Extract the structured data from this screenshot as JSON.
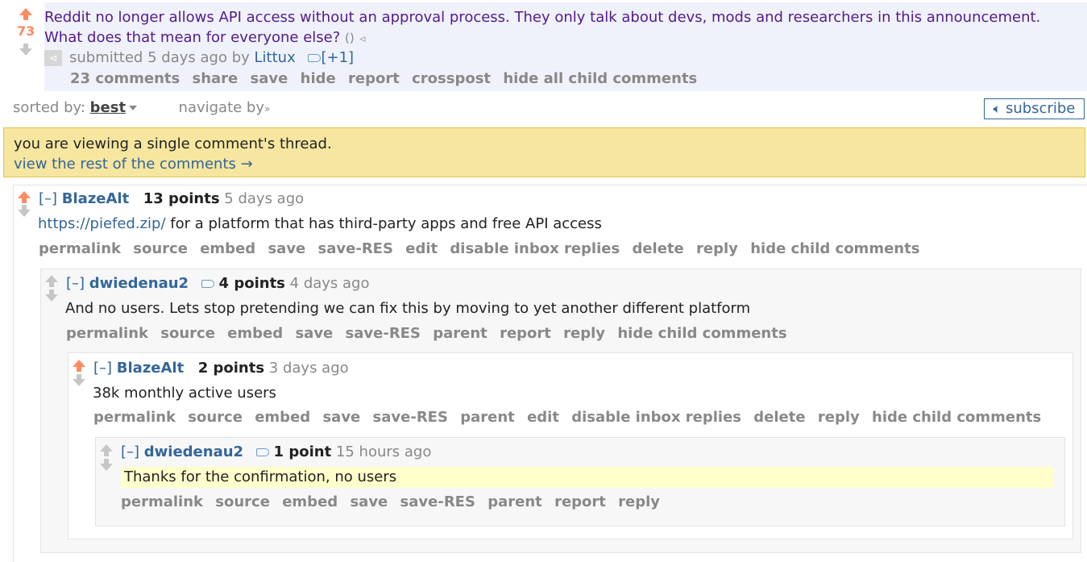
{
  "post": {
    "score": "73",
    "title": "Reddit no longer allows API access without an approval process. They only talk about devs, mods and researchers in this announcement. What does that mean for everyone else?",
    "domain": "()",
    "submitted_prefix": "submitted",
    "submitted_time": "5 days ago",
    "by": "by",
    "author": "Littux",
    "tag_plus": "[+1]",
    "buttons": [
      "23 comments",
      "share",
      "save",
      "hide",
      "report",
      "crosspost",
      "hide all child comments"
    ]
  },
  "sort": {
    "label": "sorted by:",
    "value": "best",
    "navigate": "navigate by",
    "subscribe": "subscribe"
  },
  "notice": {
    "text": "you are viewing a single comment's thread.",
    "link": "view the rest of the comments →"
  },
  "comments": [
    {
      "collapse": "[–]",
      "author": "BlazeAlt",
      "points": "13 points",
      "time": "5 days ago",
      "link": "https://piefed.zip/",
      "body": " for a platform that has third-party apps and free API access",
      "buttons": [
        "permalink",
        "source",
        "embed",
        "save",
        "save-RES",
        "edit",
        "disable inbox replies",
        "delete",
        "reply",
        "hide child comments"
      ]
    },
    {
      "collapse": "[–]",
      "author": "dwiedenau2",
      "points": "4 points",
      "time": "4 days ago",
      "body": "And no users. Lets stop pretending we can fix this by moving to yet another different platform",
      "buttons": [
        "permalink",
        "source",
        "embed",
        "save",
        "save-RES",
        "parent",
        "report",
        "reply",
        "hide child comments"
      ]
    },
    {
      "collapse": "[–]",
      "author": "BlazeAlt",
      "points": "2 points",
      "time": "3 days ago",
      "body": "38k monthly active users",
      "buttons": [
        "permalink",
        "source",
        "embed",
        "save",
        "save-RES",
        "parent",
        "edit",
        "disable inbox replies",
        "delete",
        "reply",
        "hide child comments"
      ]
    },
    {
      "collapse": "[–]",
      "author": "dwiedenau2",
      "points": "1 point",
      "time": "15 hours ago",
      "body": "Thanks for the confirmation, no users",
      "buttons": [
        "permalink",
        "source",
        "embed",
        "save",
        "save-RES",
        "parent",
        "report",
        "reply"
      ]
    }
  ]
}
